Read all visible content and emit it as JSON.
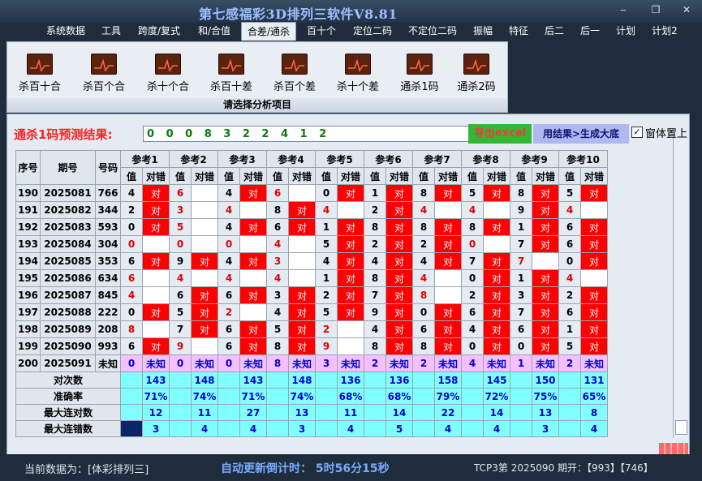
{
  "window": {
    "title": "第七感福彩3D排列三软件V8.81",
    "controls": [
      "‒",
      "❐",
      "✕"
    ]
  },
  "menu": [
    "系统数据",
    "工具",
    "跨度/复式",
    "和/合值",
    "合差/通杀",
    "百十个",
    "定位二码",
    "不定位二码",
    "振幅",
    "特征",
    "后二",
    "后一",
    "计划",
    "计划2"
  ],
  "menu_active": "合差/通杀",
  "ribbon": {
    "buttons": [
      "杀百十合",
      "杀百个合",
      "杀十个合",
      "杀百十差",
      "杀百个差",
      "杀十个差",
      "通杀1码",
      "通杀2码"
    ],
    "caption": "请选择分析项目",
    "icon": "chart-icon"
  },
  "prediction": {
    "label": "通杀1码预测结果:",
    "value": "0 0 0 8 3 2 2 4 1 2",
    "excel_button": "导出excel",
    "gen_button": "用结果>生成大底",
    "topmost_check": "✓",
    "topmost_label": "窗体置上"
  },
  "table": {
    "col_headers": [
      "序号",
      "期号",
      "号码"
    ],
    "refs": [
      "参考1",
      "参考2",
      "参考3",
      "参考4",
      "参考5",
      "参考6",
      "参考7",
      "参考8",
      "参考9",
      "参考10"
    ],
    "sub_value": "值",
    "sub_result": "对错",
    "hit_text": "对",
    "rows": [
      {
        "idx": "190",
        "issue": "2025081",
        "num": "766",
        "vals": [
          "4",
          "6",
          "4",
          "6",
          "0",
          "1",
          "8",
          "5",
          "8",
          "5"
        ],
        "hits": [
          1,
          0,
          1,
          0,
          1,
          1,
          1,
          1,
          1,
          1
        ]
      },
      {
        "idx": "191",
        "issue": "2025082",
        "num": "344",
        "vals": [
          "2",
          "3",
          "4",
          "8",
          "4",
          "2",
          "4",
          "4",
          "9",
          "4"
        ],
        "hits": [
          1,
          0,
          0,
          1,
          0,
          1,
          0,
          0,
          1,
          0
        ]
      },
      {
        "idx": "192",
        "issue": "2025083",
        "num": "593",
        "vals": [
          "0",
          "5",
          "4",
          "6",
          "1",
          "8",
          "8",
          "8",
          "1",
          "6"
        ],
        "hits": [
          1,
          0,
          1,
          1,
          1,
          1,
          1,
          1,
          1,
          1
        ]
      },
      {
        "idx": "193",
        "issue": "2025084",
        "num": "304",
        "vals": [
          "0",
          "0",
          "0",
          "4",
          "5",
          "2",
          "2",
          "0",
          "7",
          "6"
        ],
        "hits": [
          0,
          0,
          0,
          0,
          1,
          1,
          1,
          0,
          1,
          1
        ]
      },
      {
        "idx": "194",
        "issue": "2025085",
        "num": "353",
        "vals": [
          "6",
          "9",
          "4",
          "3",
          "4",
          "4",
          "4",
          "7",
          "7",
          "0"
        ],
        "hits": [
          1,
          1,
          1,
          0,
          1,
          1,
          1,
          1,
          0,
          1
        ]
      },
      {
        "idx": "195",
        "issue": "2025086",
        "num": "634",
        "vals": [
          "6",
          "4",
          "4",
          "4",
          "1",
          "8",
          "4",
          "0",
          "1",
          "4"
        ],
        "hits": [
          0,
          0,
          0,
          0,
          1,
          1,
          0,
          1,
          1,
          0
        ]
      },
      {
        "idx": "196",
        "issue": "2025087",
        "num": "845",
        "vals": [
          "4",
          "6",
          "6",
          "3",
          "2",
          "7",
          "8",
          "2",
          "3",
          "2"
        ],
        "hits": [
          0,
          1,
          1,
          1,
          1,
          1,
          0,
          1,
          1,
          1
        ]
      },
      {
        "idx": "197",
        "issue": "2025088",
        "num": "222",
        "vals": [
          "0",
          "5",
          "2",
          "4",
          "5",
          "9",
          "0",
          "6",
          "7",
          "6"
        ],
        "hits": [
          1,
          1,
          0,
          1,
          1,
          1,
          1,
          1,
          1,
          1
        ]
      },
      {
        "idx": "198",
        "issue": "2025089",
        "num": "208",
        "vals": [
          "8",
          "7",
          "6",
          "5",
          "2",
          "4",
          "6",
          "4",
          "6",
          "1"
        ],
        "hits": [
          0,
          1,
          1,
          1,
          0,
          1,
          1,
          1,
          1,
          1
        ]
      },
      {
        "idx": "199",
        "issue": "2025090",
        "num": "993",
        "vals": [
          "6",
          "9",
          "6",
          "8",
          "9",
          "8",
          "8",
          "0",
          "0",
          "5"
        ],
        "hits": [
          1,
          0,
          1,
          1,
          0,
          1,
          1,
          1,
          1,
          1
        ]
      }
    ],
    "pred_row": {
      "idx": "200",
      "issue": "2025091",
      "num": "未知",
      "vals": [
        "0",
        "0",
        "0",
        "8",
        "3",
        "2",
        "2",
        "4",
        "1",
        "2"
      ],
      "res": "未知"
    },
    "stats": [
      {
        "label": "对次数",
        "values": [
          "143",
          "148",
          "143",
          "148",
          "136",
          "136",
          "158",
          "145",
          "150",
          "131"
        ]
      },
      {
        "label": "准确率",
        "values": [
          "71%",
          "74%",
          "71%",
          "74%",
          "68%",
          "68%",
          "79%",
          "72%",
          "75%",
          "65%"
        ]
      },
      {
        "label": "最大连对数",
        "values": [
          "12",
          "11",
          "27",
          "13",
          "11",
          "14",
          "22",
          "14",
          "13",
          "8"
        ]
      },
      {
        "label": "最大连错数",
        "values": [
          "3",
          "4",
          "4",
          "3",
          "4",
          "5",
          "4",
          "4",
          "3",
          "4"
        ]
      }
    ]
  },
  "status": {
    "current": "当前数据为：[体彩排列三]",
    "countdown": "自动更新倒计时： 5时56分15秒",
    "draw": "TCP3第 2025090 期开：【993】【746】"
  }
}
